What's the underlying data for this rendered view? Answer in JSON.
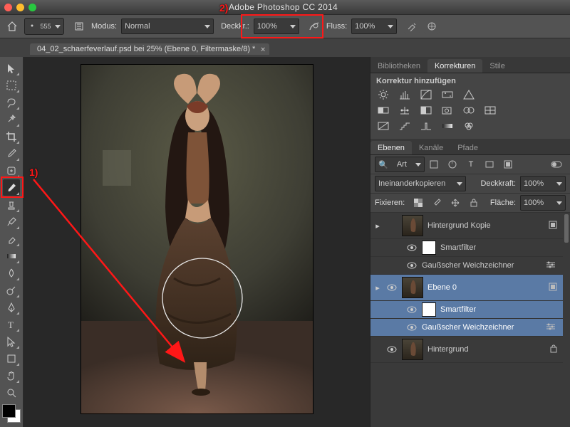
{
  "app": {
    "title": "Adobe Photoshop CC 2014"
  },
  "window_buttons": {
    "close": "#ff5f57",
    "min": "#ffbd2e",
    "max": "#28c840"
  },
  "options_bar": {
    "brush_size": "555",
    "mode_label": "Modus:",
    "mode_value": "Normal",
    "opacity_label": "Deckkr.:",
    "opacity_value": "100%",
    "flow_label": "Fluss:",
    "flow_value": "100%"
  },
  "annotations": {
    "one": "1)",
    "two": "2)"
  },
  "document": {
    "tab_title": "04_02_schaerfeverlauf.psd bei 25% (Ebene 0, Filtermaske/8) *"
  },
  "tools": [
    {
      "name": "move-tool"
    },
    {
      "name": "marquee-tool"
    },
    {
      "name": "lasso-tool"
    },
    {
      "name": "magic-wand-tool"
    },
    {
      "name": "crop-tool"
    },
    {
      "name": "eyedropper-tool"
    },
    {
      "name": "healing-brush-tool"
    },
    {
      "name": "brush-tool"
    },
    {
      "name": "clone-stamp-tool"
    },
    {
      "name": "history-brush-tool"
    },
    {
      "name": "eraser-tool"
    },
    {
      "name": "gradient-tool"
    },
    {
      "name": "blur-tool"
    },
    {
      "name": "dodge-tool"
    },
    {
      "name": "pen-tool"
    },
    {
      "name": "type-tool"
    },
    {
      "name": "path-select-tool"
    },
    {
      "name": "shape-tool"
    },
    {
      "name": "hand-tool"
    },
    {
      "name": "zoom-tool"
    }
  ],
  "swatches": {
    "fg": "#000000",
    "bg": "#ffffff"
  },
  "panel_group1": {
    "tabs": [
      "Bibliotheken",
      "Korrekturen",
      "Stile"
    ],
    "active": 1,
    "heading": "Korrektur hinzufügen"
  },
  "panel_group2": {
    "tabs": [
      "Ebenen",
      "Kanäle",
      "Pfade"
    ],
    "active": 0,
    "filter_value": "Art",
    "blend": {
      "mode": "Ineinanderkopieren",
      "opacity_label": "Deckkraft:",
      "opacity_value": "100%"
    },
    "lock": {
      "label": "Fixieren:",
      "fill_label": "Fläche:",
      "fill_value": "100%"
    },
    "layers": [
      {
        "name": "Hintergrund Kopie",
        "visible": false,
        "type": "smart",
        "children": [
          {
            "name": "Smartfilter",
            "type": "mask"
          },
          {
            "name": "Gaußscher Weichzeichner",
            "type": "filter"
          }
        ]
      },
      {
        "name": "Ebene 0",
        "visible": true,
        "type": "smart",
        "selected": true,
        "children": [
          {
            "name": "Smartfilter",
            "type": "mask"
          },
          {
            "name": "Gaußscher Weichzeichner",
            "type": "filter"
          }
        ]
      },
      {
        "name": "Hintergrund",
        "visible": true,
        "type": "bg"
      }
    ]
  }
}
